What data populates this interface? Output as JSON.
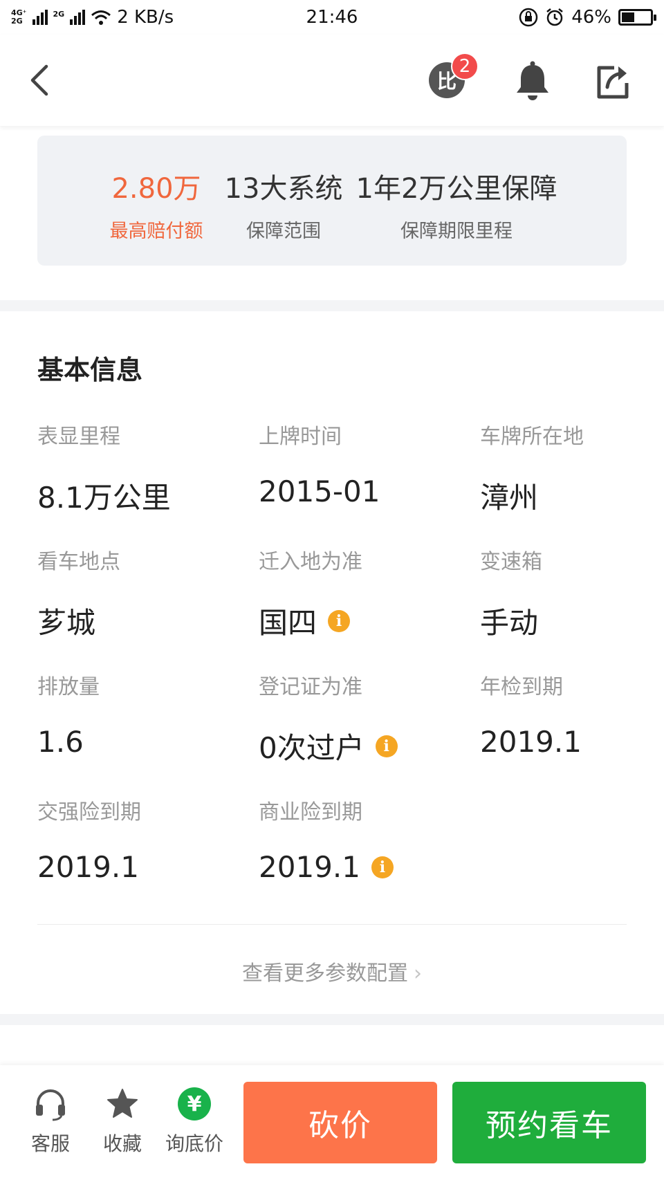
{
  "status_bar": {
    "network_top": "4G⁺",
    "network_bottom": "2G",
    "network_small": "2G",
    "speed": "2 KB/s",
    "time": "21:46",
    "battery": "46%",
    "battery_level": 0.46
  },
  "nav": {
    "back_icon": "chevron-left-icon",
    "compare_label": "比",
    "compare_count": "2",
    "bell_icon": "bell-icon",
    "share_icon": "share-icon"
  },
  "guarantee": {
    "items": [
      {
        "value": "2.80万",
        "label": "最高赔付额"
      },
      {
        "value": "13大系统",
        "label": "保障范围"
      },
      {
        "value": "1年2万公里保障",
        "label": "保障期限里程"
      }
    ],
    "accent_color": "#f0673d"
  },
  "basic_info": {
    "title": "基本信息",
    "items": [
      {
        "label": "表显里程",
        "value": "8.1万公里"
      },
      {
        "label": "上牌时间",
        "value": "2015-01"
      },
      {
        "label": "车牌所在地",
        "value": "漳州"
      },
      {
        "label": "看车地点",
        "value": "芗城"
      },
      {
        "label": "迁入地为准",
        "value": "国四"
      },
      {
        "label": "变速箱",
        "value": "手动"
      },
      {
        "label": "排放量",
        "value": "1.6"
      },
      {
        "label": "登记证为准",
        "value": "0次过户"
      },
      {
        "label": "年检到期",
        "value": "2019.1"
      },
      {
        "label": "交强险到期",
        "value": "2019.1"
      },
      {
        "label": "商业险到期",
        "value": "2019.1"
      }
    ],
    "info_icon": "i",
    "more_link": "查看更多参数配置",
    "more_chevron": "›"
  },
  "bottom_bar": {
    "service_label": "客服",
    "favorite_label": "收藏",
    "price_inquiry_label": "询底价",
    "yuan_symbol": "¥",
    "bargain_button": "砍价",
    "book_button": "预约看车",
    "bargain_color": "#fd744a",
    "book_color": "#1fad3c"
  }
}
